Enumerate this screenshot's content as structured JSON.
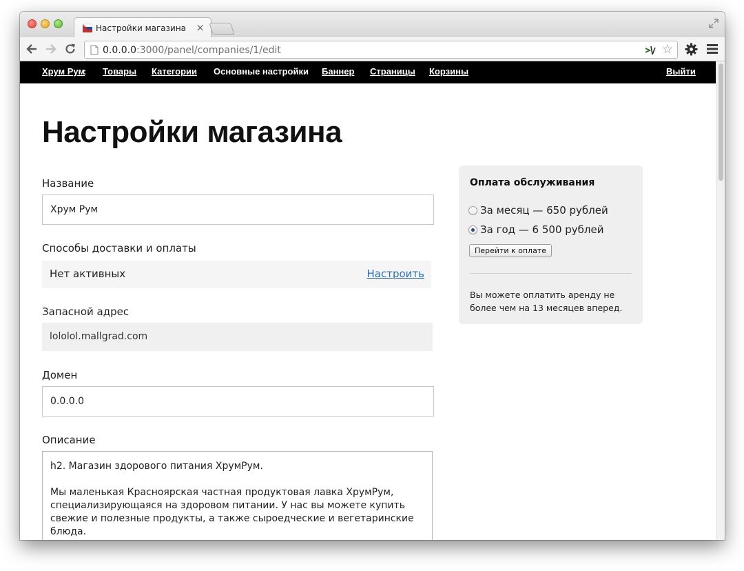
{
  "browser": {
    "tab_title": "Настройки магазина",
    "tab_close": "×",
    "url_host": "0.0.0.0",
    "url_rest": ":3000/panel/companies/1/edit"
  },
  "nav": {
    "brand": "Хрум Рум",
    "brand_colon": ":",
    "items": [
      "Товары",
      "Категории",
      "Основные настройки",
      "Баннер",
      "Страницы",
      "Корзины"
    ],
    "logout": "Выйти"
  },
  "page": {
    "title": "Настройки магазина"
  },
  "form": {
    "name_label": "Название",
    "name_value": "Хрум Рум",
    "delivery_label": "Способы доставки и оплаты",
    "delivery_status": "Нет активных",
    "delivery_configure": "Настроить",
    "backup_label": "Запасной адрес",
    "backup_value": "lololol.mallgrad.com",
    "domain_label": "Домен",
    "domain_value": "0.0.0.0",
    "description_label": "Описание",
    "description_value": "h2. Магазин здорового питания ХрумРум.\n\nМы маленькая Красноярская частная продуктовая лавка ХрумРум, специализирующаяся на здоровом питании. У нас вы можете купить свежие и полезные продукты, а также сыроедческие и вегетаринские блюда.\n\nСкромный размер коллектива (из двух человек :-)) магазина позволяет"
  },
  "payment": {
    "title": "Оплата обслуживания",
    "option_month": "За месяц — 650 рублей",
    "option_year": "За год — 6 500 рублей",
    "selected": "year",
    "pay_button": "Перейти к оплате",
    "note": "Вы можете оплатить аренду не более чем на 13 месяцев вперед."
  },
  "colors": {
    "nav_bg": "#000000",
    "link": "#2a6ebb",
    "panel_bg": "#efefef"
  }
}
